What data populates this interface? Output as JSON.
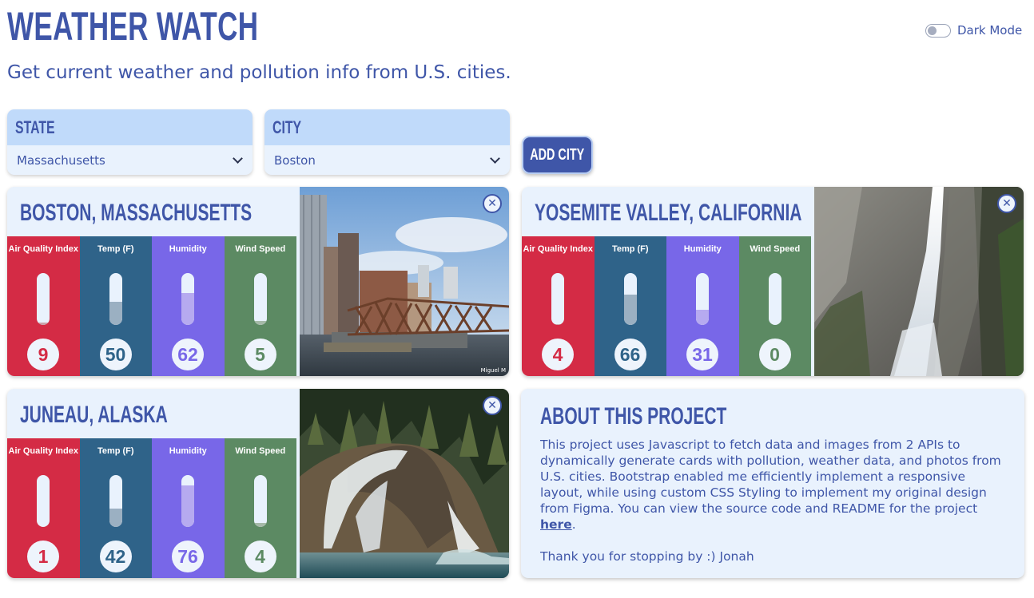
{
  "header": {
    "title": "WEATHER WATCH",
    "subtitle": "Get current weather and pollution info from U.S. cities.",
    "dark_mode_label": "Dark Mode",
    "dark_mode_on": false
  },
  "form": {
    "state_label": "STATE",
    "state_value": "Massachusetts",
    "city_label": "CITY",
    "city_value": "Boston",
    "add_button": "ADD CITY"
  },
  "metric_labels": {
    "aqi": "Air Quality Index",
    "temp": "Temp (F)",
    "humidity": "Humidity",
    "wind": "Wind Speed"
  },
  "cards": [
    {
      "title": "BOSTON, MASSACHUSETTS",
      "aqi": "9",
      "temp": "50",
      "humidity": "62",
      "wind": "5",
      "levels": {
        "aqi": 0.05,
        "temp": 0.45,
        "humidity": 0.62,
        "wind": 0.08
      },
      "photo": "harbor-bridge-skyline",
      "credit": "Miguel M"
    },
    {
      "title": "YOSEMITE VALLEY, CALIFORNIA",
      "aqi": "4",
      "temp": "66",
      "humidity": "31",
      "wind": "0",
      "levels": {
        "aqi": 0.02,
        "temp": 0.58,
        "humidity": 0.3,
        "wind": 0.0
      },
      "photo": "waterfall-cliff"
    },
    {
      "title": "JUNEAU, ALASKA",
      "aqi": "1",
      "temp": "42",
      "humidity": "76",
      "wind": "4",
      "levels": {
        "aqi": 0.0,
        "temp": 0.36,
        "humidity": 0.8,
        "wind": 0.08
      },
      "photo": "waterfall-rock-forest"
    }
  ],
  "about": {
    "title": "ABOUT THIS PROJECT",
    "text": "This project uses Javascript to fetch data and images from 2 APIs to dynamically generate cards with pollution, weather data, and photos from U.S. cities. Bootstrap enabled me efficiently implement a responsive layout, while using custom CSS Styling to implement my original design from Figma. You can view the source code and README for the project ",
    "link": "here",
    "after_link": ".",
    "thanks": "Thank you for stopping by :) Jonah"
  },
  "colors": {
    "primary": "#3f56a8",
    "aqi": "#d42b45",
    "temp": "#2f6389",
    "humidity": "#7867e8",
    "wind": "#5c8a63",
    "card_bg": "#e9f2fd",
    "select_head": "#c0dafa"
  },
  "icons": {
    "close": "close-icon",
    "dropdown": "chevron-down-icon"
  }
}
